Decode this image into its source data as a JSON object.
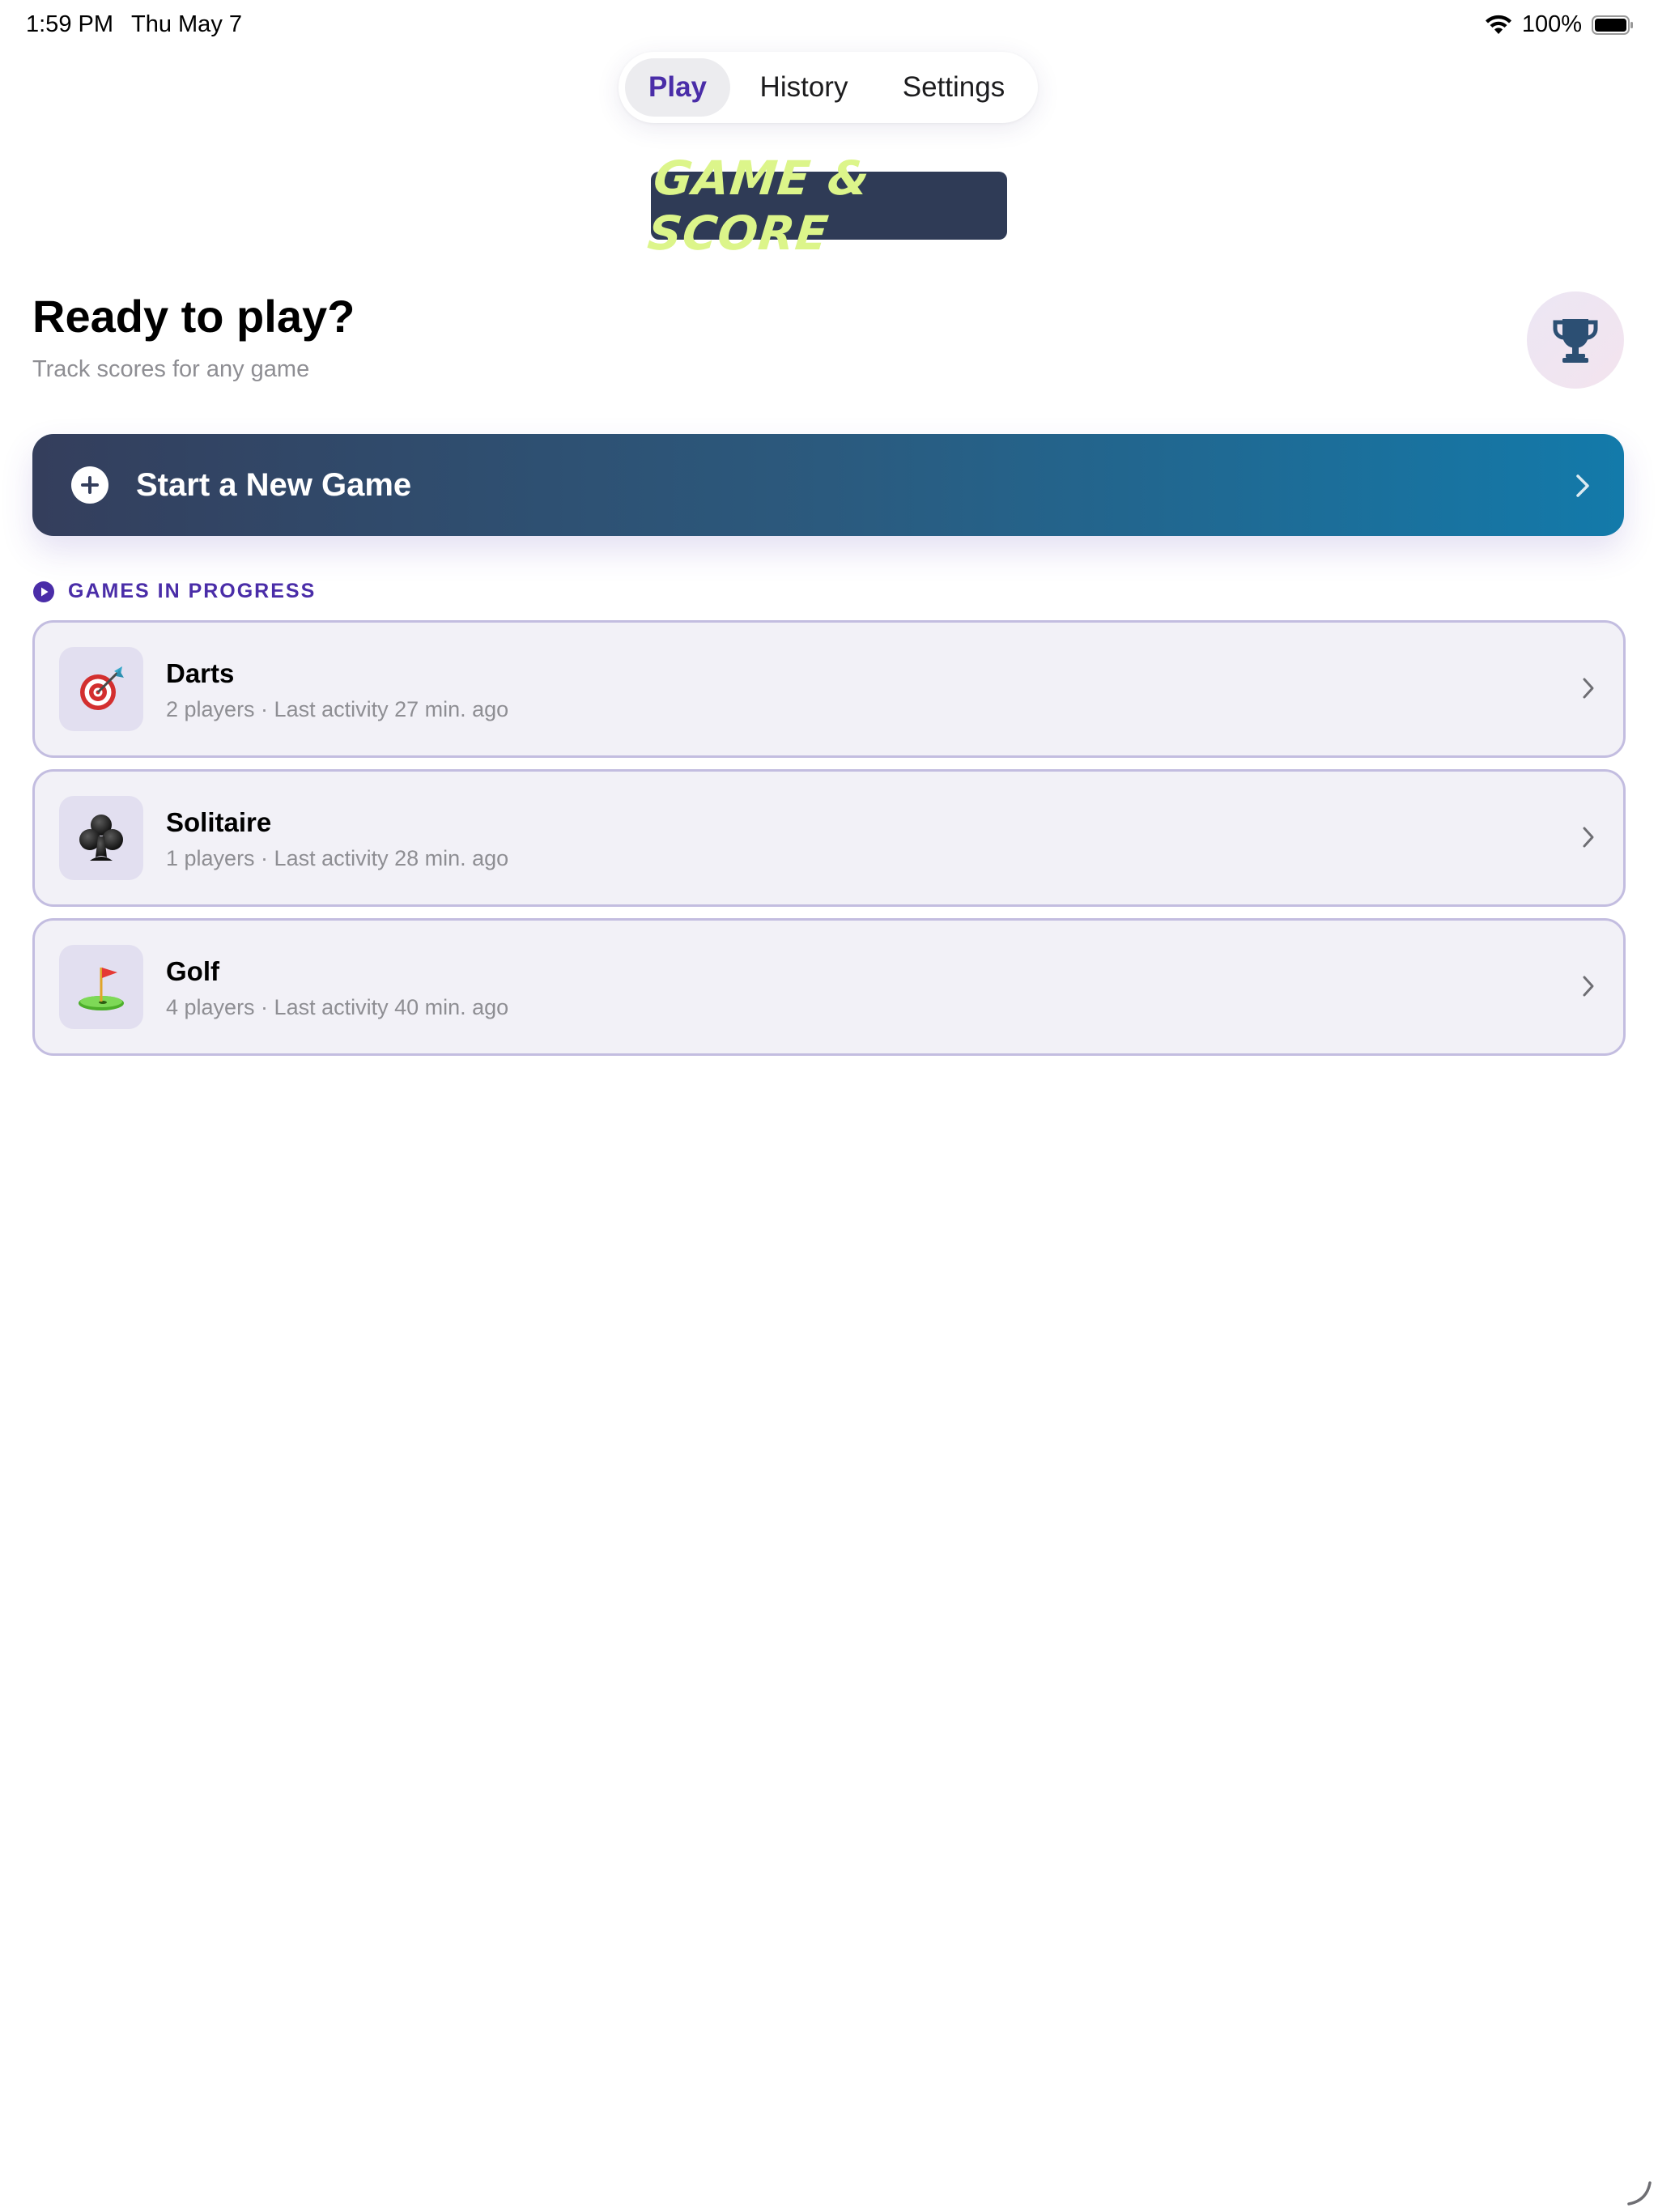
{
  "status_bar": {
    "time": "1:59 PM",
    "date": "Thu May 7",
    "battery_percent": "100%",
    "icons": [
      "wifi-icon",
      "battery-icon"
    ]
  },
  "tabs": [
    {
      "label": "Play",
      "active": true
    },
    {
      "label": "History",
      "active": false
    },
    {
      "label": "Settings",
      "active": false
    }
  ],
  "logo": {
    "text": "GAME & SCORE"
  },
  "header": {
    "title": "Ready to play?",
    "subtitle": "Track scores for any game",
    "trophy_icon": "trophy-icon"
  },
  "start_game": {
    "label": "Start a New Game",
    "icon": "plus-circle-icon"
  },
  "section": {
    "title": "GAMES IN PROGRESS",
    "icon": "play-circle-icon"
  },
  "games": [
    {
      "name": "Darts",
      "meta": "2 players · Last activity 27 min. ago",
      "icon": "🎯"
    },
    {
      "name": "Solitaire",
      "meta": "1 players · Last activity 28 min. ago",
      "icon": "♣"
    },
    {
      "name": "Golf",
      "meta": "4 players · Last activity 40 min. ago",
      "icon": "⛳"
    }
  ],
  "colors": {
    "accent": "#4a2da8",
    "logo_bg": "#2f3b56",
    "logo_text": "#dcf58a",
    "start_gradient_from": "#343e5c",
    "start_gradient_to": "#137aaa",
    "card_bg": "#f2f1f7",
    "card_border": "#c3bde0",
    "trophy": "#2c4f73"
  }
}
